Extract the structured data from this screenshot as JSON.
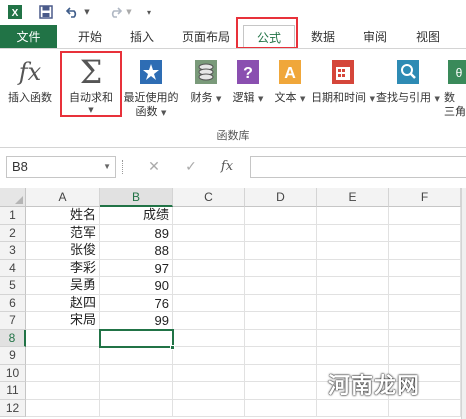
{
  "qat": {
    "save_icon": "save-icon",
    "undo_icon": "undo-icon",
    "redo_icon": "redo-icon",
    "customize_icon": "customize-qat-icon"
  },
  "tabs": [
    {
      "label": "文件"
    },
    {
      "label": "开始"
    },
    {
      "label": "插入"
    },
    {
      "label": "页面布局"
    },
    {
      "label": "公式"
    },
    {
      "label": "数据"
    },
    {
      "label": "审阅"
    },
    {
      "label": "视图"
    }
  ],
  "ribbon": {
    "buttons": [
      {
        "label": "插入函数",
        "icon": "fx-icon"
      },
      {
        "label": "自动求和",
        "icon": "sigma-icon"
      },
      {
        "label": "最近使用的",
        "label2": "函数",
        "icon": "star-icon"
      },
      {
        "label": "财务",
        "icon": "coins-icon"
      },
      {
        "label": "逻辑",
        "icon": "question-book-icon"
      },
      {
        "label": "文本",
        "icon": "text-book-icon"
      },
      {
        "label": "日期和时间",
        "icon": "calendar-icon"
      },
      {
        "label": "查找与引用",
        "icon": "search-book-icon"
      },
      {
        "label": "数",
        "label2": "三角",
        "icon": "math-icon"
      }
    ],
    "group_label": "函数库"
  },
  "formula_bar": {
    "name_box": "B8",
    "cancel_icon": "cancel-icon",
    "enter_icon": "check-icon",
    "fx_label": "fx",
    "formula": ""
  },
  "grid": {
    "columns": [
      "A",
      "B",
      "C",
      "D",
      "E",
      "F"
    ],
    "rows": [
      "1",
      "2",
      "3",
      "4",
      "5",
      "6",
      "7",
      "8",
      "9",
      "10",
      "11",
      "12"
    ],
    "data": [
      [
        "姓名",
        "成绩"
      ],
      [
        "范军",
        "89"
      ],
      [
        "张俊",
        "88"
      ],
      [
        "李彩",
        "97"
      ],
      [
        "吴勇",
        "90"
      ],
      [
        "赵四",
        "76"
      ],
      [
        "宋局",
        "99"
      ]
    ],
    "selected_cell": "B8"
  },
  "watermark": "河南龙网",
  "colors": {
    "excel_green": "#217346",
    "highlight_red": "#e8313a"
  }
}
